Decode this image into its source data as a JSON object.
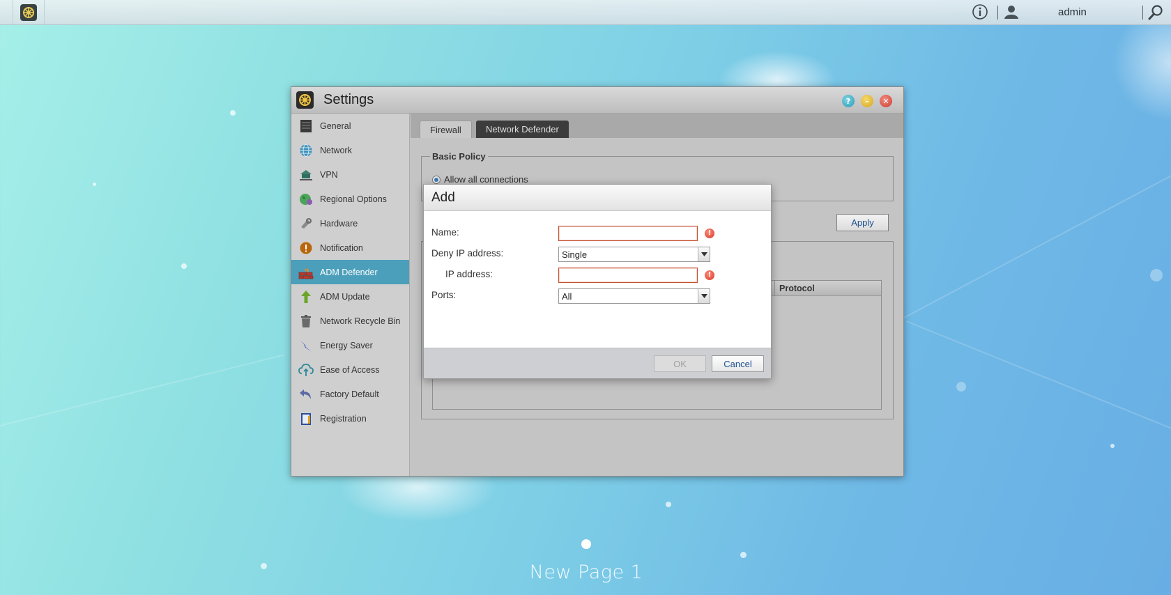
{
  "topbar": {
    "user_name": "admin"
  },
  "window": {
    "title": "Settings"
  },
  "sidebar": {
    "items": [
      {
        "label": "General",
        "icon": "general-icon"
      },
      {
        "label": "Network",
        "icon": "globe-icon"
      },
      {
        "label": "VPN",
        "icon": "vpn-icon"
      },
      {
        "label": "Regional Options",
        "icon": "regional-globe-icon"
      },
      {
        "label": "Hardware",
        "icon": "hardware-icon"
      },
      {
        "label": "Notification",
        "icon": "notification-icon"
      },
      {
        "label": "ADM Defender",
        "icon": "firewall-icon",
        "active": true
      },
      {
        "label": "ADM Update",
        "icon": "update-arrow-icon"
      },
      {
        "label": "Network Recycle Bin",
        "icon": "trash-icon"
      },
      {
        "label": "Energy Saver",
        "icon": "lightning-icon"
      },
      {
        "label": "Ease of Access",
        "icon": "cloud-upload-icon"
      },
      {
        "label": "Factory Default",
        "icon": "undo-arrow-icon"
      },
      {
        "label": "Registration",
        "icon": "clipboard-icon"
      }
    ]
  },
  "tabs": {
    "firewall": "Firewall",
    "network_defender": "Network Defender"
  },
  "policy": {
    "legend": "Basic Policy",
    "option_allow": "Allow all connections"
  },
  "apply_label": "Apply",
  "rules_grid": {
    "column_protocol": "Protocol"
  },
  "dialog": {
    "title": "Add",
    "name_label": "Name:",
    "name_value": "",
    "deny_label": "Deny IP address:",
    "deny_value": "Single",
    "ip_label": "IP address:",
    "ip_value": "",
    "ports_label": "Ports:",
    "ports_value": "All",
    "ok_label": "OK",
    "cancel_label": "Cancel",
    "error_mark": "!"
  },
  "page": {
    "label": "New Page 1"
  },
  "colors": {
    "sidebar_active": "#4b9fbb",
    "error": "#d63b2b",
    "link_blue": "#1d4f8f"
  }
}
